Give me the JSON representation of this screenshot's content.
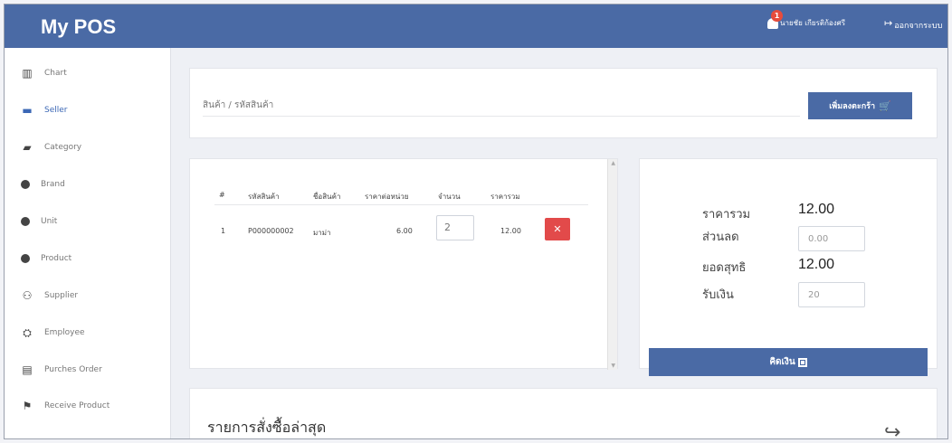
{
  "app": {
    "title": "My POS"
  },
  "header": {
    "notification_count": "1",
    "user_name": "นายชัย เกียรติก้องศรี",
    "logout_label": "ออกจากระบบ"
  },
  "sidebar": {
    "items": [
      {
        "label": "Chart",
        "icon": "chart-icon"
      },
      {
        "label": "Seller",
        "icon": "store-icon",
        "active": true
      },
      {
        "label": "Category",
        "icon": "category-icon"
      },
      {
        "label": "Brand",
        "icon": "brand-icon"
      },
      {
        "label": "Unit",
        "icon": "unit-icon"
      },
      {
        "label": "Product",
        "icon": "product-icon"
      },
      {
        "label": "Supplier",
        "icon": "supplier-icon"
      },
      {
        "label": "Employee",
        "icon": "employee-icon"
      },
      {
        "label": "Purches Order",
        "icon": "document-icon"
      },
      {
        "label": "Receive Product",
        "icon": "receive-icon"
      }
    ]
  },
  "search": {
    "placeholder": "สินค้า / รหัสสินค้า",
    "button_label": "เพิ่มลงตะกร้า"
  },
  "cart": {
    "headers": [
      "#",
      "รหัสสินค้า",
      "ชื่อสินค้า",
      "ราคาต่อหน่วย",
      "จำนวน",
      "ราคารวม"
    ],
    "rows": [
      {
        "index": "1",
        "code": "P000000002",
        "name": "มาม่า",
        "unit_price": "6.00",
        "quantity": "2",
        "total": "12.00"
      }
    ]
  },
  "summary": {
    "total_label": "ราคารวม",
    "total_value": "12.00",
    "discount_label": "ส่วนลด",
    "discount_value": "0.00",
    "net_label": "ยอดสุทธิ",
    "net_value": "12.00",
    "received_label": "รับเงิน",
    "received_value": "20",
    "pay_button_label": "คิดเงิน"
  },
  "recent": {
    "title": "รายการสั่งซื้อล่าสุด"
  },
  "colors": {
    "primary": "#4a6aa5",
    "danger": "#e24a4a",
    "sidebar_active": "#3b67b5"
  }
}
